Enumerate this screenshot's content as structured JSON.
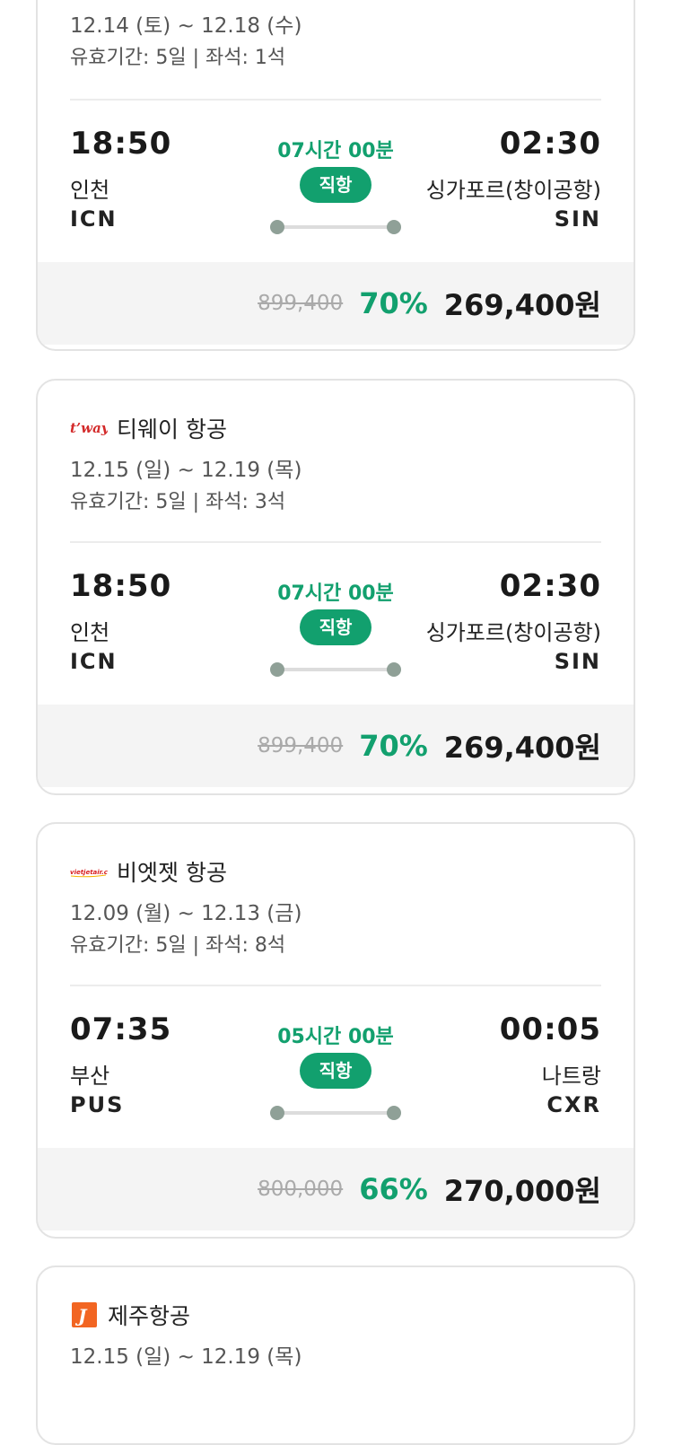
{
  "cards": [
    {
      "airline": "",
      "dates": "12.14 (토) ~ 12.18 (수)",
      "meta": "유효기간: 5일 | 좌석: 1석",
      "dep_time": "18:50",
      "dep_city": "인천",
      "dep_code": "ICN",
      "arr_time": "02:30",
      "arr_city": "싱가포르(창이공항)",
      "arr_code": "SIN",
      "duration": "07시간 00분",
      "badge": "직항",
      "orig_price": "899,400",
      "discount": "70%",
      "price": "269,400원"
    },
    {
      "airline": "티웨이 항공",
      "logo": "t'way",
      "dates": "12.15 (일) ~ 12.19 (목)",
      "meta": "유효기간: 5일 | 좌석: 3석",
      "dep_time": "18:50",
      "dep_city": "인천",
      "dep_code": "ICN",
      "arr_time": "02:30",
      "arr_city": "싱가포르(창이공항)",
      "arr_code": "SIN",
      "duration": "07시간 00분",
      "badge": "직항",
      "orig_price": "899,400",
      "discount": "70%",
      "price": "269,400원"
    },
    {
      "airline": "비엣젯 항공",
      "logo": "vietjetair.com",
      "dates": "12.09 (월) ~ 12.13 (금)",
      "meta": "유효기간: 5일 | 좌석: 8석",
      "dep_time": "07:35",
      "dep_city": "부산",
      "dep_code": "PUS",
      "arr_time": "00:05",
      "arr_city": "나트랑",
      "arr_code": "CXR",
      "duration": "05시간 00분",
      "badge": "직항",
      "orig_price": "800,000",
      "discount": "66%",
      "price": "270,000원"
    },
    {
      "airline": "제주항공",
      "logo": "J",
      "dates": "12.15 (일) ~ 12.19 (목)"
    }
  ],
  "icons": [
    "tway-logo-icon",
    "vietjet-logo-icon",
    "jejuair-logo-icon"
  ],
  "colors": {
    "accent": "#12a06e",
    "price_bg": "#f4f4f4",
    "route_dot": "#8fa097"
  }
}
